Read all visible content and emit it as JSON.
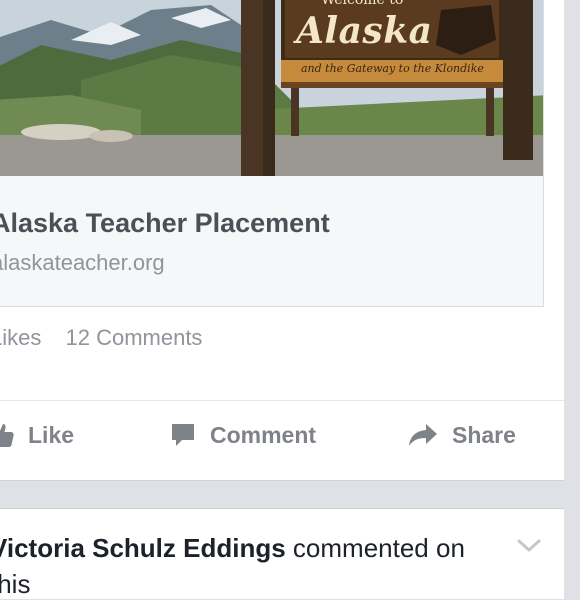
{
  "post": {
    "sign": {
      "top_text": "Welcome to",
      "title": "Alaska",
      "bottom_text": "and the Gateway to the Klondike"
    },
    "link": {
      "title": "Alaska Teacher Placement",
      "domain": "alaskateacher.org"
    },
    "stats": {
      "likes": "Likes",
      "comments": "12 Comments"
    },
    "actions": {
      "like": "Like",
      "comment": "Comment",
      "share": "Share"
    }
  },
  "next_story": {
    "author": "Victoria Schulz Eddings",
    "action": "commented on",
    "continued": "this"
  },
  "colors": {
    "background": "#dfe1e6",
    "card": "#ffffff",
    "link_title": "#4b4f56",
    "muted": "#90949c",
    "action": "#7f8389"
  },
  "icons": [
    "thumbs-up-icon",
    "comment-bubble-icon",
    "share-arrow-icon",
    "chevron-down-icon"
  ]
}
